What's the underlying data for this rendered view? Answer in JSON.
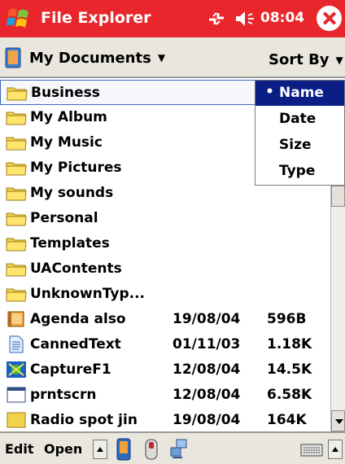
{
  "titlebar": {
    "title": "File Explorer",
    "clock": "08:04",
    "icons": [
      "windows-start-icon",
      "signal-icon",
      "speaker-icon",
      "close-icon"
    ],
    "colors": {
      "background": "#e8262b",
      "text": "#ffffff"
    }
  },
  "navbar": {
    "folder": "My Documents",
    "sort_label": "Sort By"
  },
  "files": [
    {
      "name": "Business",
      "date": "",
      "size": "",
      "icon": "folder-icon",
      "selected": true
    },
    {
      "name": "My Album",
      "date": "",
      "size": "",
      "icon": "folder-icon"
    },
    {
      "name": "My Music",
      "date": "",
      "size": "",
      "icon": "folder-icon"
    },
    {
      "name": "My Pictures",
      "date": "",
      "size": "",
      "icon": "folder-icon"
    },
    {
      "name": "My sounds",
      "date": "",
      "size": "",
      "icon": "folder-icon"
    },
    {
      "name": "Personal",
      "date": "",
      "size": "",
      "icon": "folder-icon"
    },
    {
      "name": "Templates",
      "date": "",
      "size": "",
      "icon": "folder-icon"
    },
    {
      "name": "UAContents",
      "date": "",
      "size": "",
      "icon": "folder-icon"
    },
    {
      "name": "UnknownTyp...",
      "date": "",
      "size": "",
      "icon": "folder-icon"
    },
    {
      "name": "Agenda also",
      "date": "19/08/04",
      "size": "596B",
      "icon": "agenda-icon"
    },
    {
      "name": "CannedText",
      "date": "01/11/03",
      "size": "1.18K",
      "icon": "document-icon"
    },
    {
      "name": "CaptureF1",
      "date": "12/08/04",
      "size": "14.5K",
      "icon": "capture-icon"
    },
    {
      "name": "prntscrn",
      "date": "12/08/04",
      "size": "6.58K",
      "icon": "window-icon"
    },
    {
      "name": "Radio spot jin",
      "date": "19/08/04",
      "size": "164K",
      "icon": "media-icon"
    }
  ],
  "sort_menu": {
    "items": [
      {
        "label": "Name",
        "active": true
      },
      {
        "label": "Date",
        "active": false
      },
      {
        "label": "Size",
        "active": false
      },
      {
        "label": "Type",
        "active": false
      }
    ]
  },
  "bottombar": {
    "edit_label": "Edit",
    "open_label": "Open",
    "icons": [
      "up-arrow-icon",
      "pda-icon",
      "mouse-icon",
      "network-icon",
      "keyboard-icon"
    ]
  }
}
